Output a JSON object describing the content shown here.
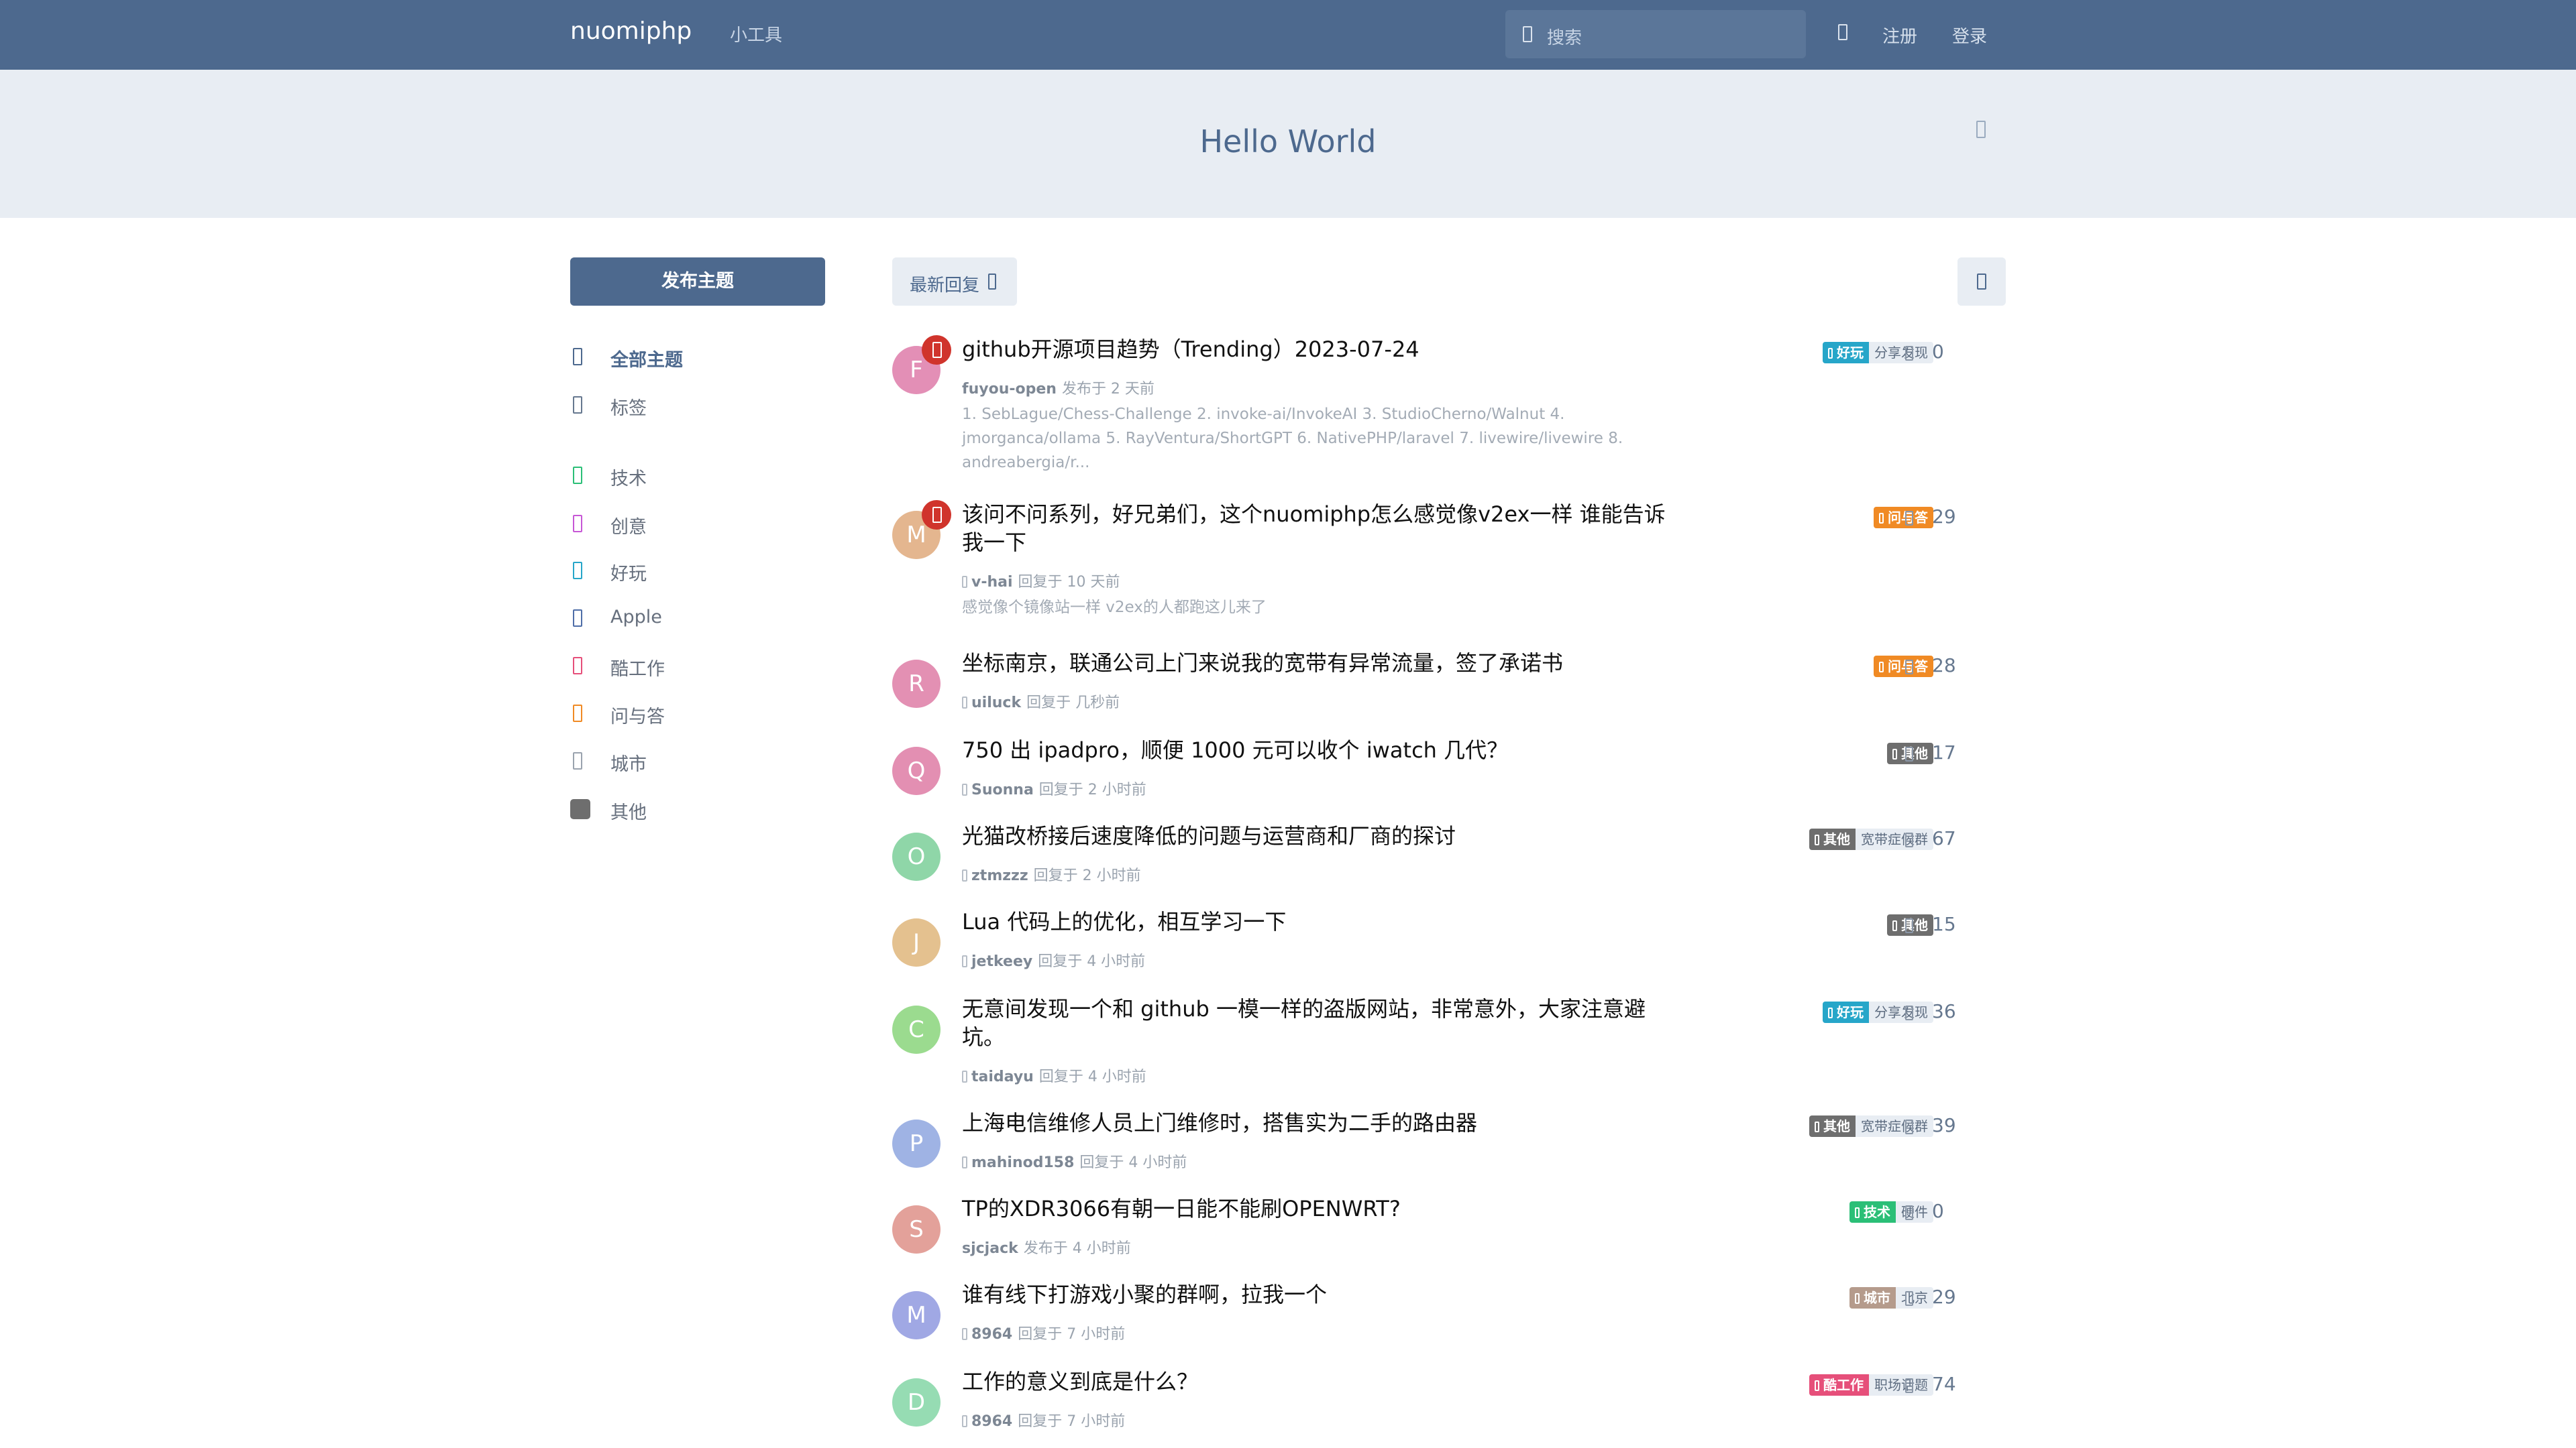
{
  "header": {
    "brand": "nuomiphp",
    "nav_tools": "小工具",
    "search_placeholder": "搜索",
    "register": "注册",
    "login": "登录"
  },
  "hero": {
    "title": "Hello World"
  },
  "sidebar": {
    "new_discussion": "发布主题",
    "items": [
      {
        "label": "全部主题",
        "icon": "comments-icon",
        "color": "#4d698e"
      },
      {
        "label": "标签",
        "icon": "tags-icon",
        "color": "#66788f"
      },
      {
        "label": "技术",
        "icon": "tag-icon",
        "color": "#2bbf77"
      },
      {
        "label": "创意",
        "icon": "tag-icon",
        "color": "#c757d6"
      },
      {
        "label": "好玩",
        "icon": "tag-icon",
        "color": "#26a6c9"
      },
      {
        "label": "Apple",
        "icon": "tag-icon",
        "color": "#4f6ea8"
      },
      {
        "label": "酷工作",
        "icon": "tag-icon",
        "color": "#e64f7a"
      },
      {
        "label": "问与答",
        "icon": "tag-icon",
        "color": "#f08a24"
      },
      {
        "label": "城市",
        "icon": "tag-icon",
        "color": "#9aa3ae"
      },
      {
        "label": "其他",
        "icon": "tag-square-icon",
        "color": "#6e6e6e"
      }
    ]
  },
  "toolbar": {
    "sort_label": "最新回复"
  },
  "discussions": [
    {
      "avatar": "F",
      "avatar_color": "#e38fb6",
      "sticky": true,
      "title": "github开源项目趋势（Trending）2023-07-24",
      "user": "fuyou-open",
      "time": "发布于 2 天前",
      "reply_icon": false,
      "excerpt": "1. SebLague/Chess-Challenge 2. invoke-ai/InvokeAI 3. StudioCherno/Walnut 4. jmorganca/ollama 5. RayVentura/ShortGPT 6. NativePHP/laravel 7. livewire/livewire 8. andreabergia/r...",
      "tag_primary": "好玩",
      "tag_color": "#26a6c9",
      "tag_secondary": "分享发现",
      "count": "0"
    },
    {
      "avatar": "M",
      "avatar_color": "#e4b68f",
      "sticky": true,
      "title": "该问不问系列，好兄弟们，这个nuomiphp怎么感觉像v2ex一样 谁能告诉我一下",
      "user": "v-hai",
      "time": "回复于 10 天前",
      "reply_icon": true,
      "excerpt": "感觉像个镜像站一样 v2ex的人都跑这儿来了",
      "tag_primary": "问与答",
      "tag_color": "#f08a24",
      "tag_secondary": "",
      "count": "29"
    },
    {
      "avatar": "R",
      "avatar_color": "#e390b3",
      "sticky": false,
      "title": "坐标南京，联通公司上门来说我的宽带有异常流量，签了承诺书",
      "user": "uiluck",
      "time": "回复于 几秒前",
      "reply_icon": true,
      "excerpt": "",
      "tag_primary": "问与答",
      "tag_color": "#f08a24",
      "tag_secondary": "",
      "count": "28"
    },
    {
      "avatar": "Q",
      "avatar_color": "#e38fb2",
      "sticky": false,
      "title": "750 出 ipadpro，顺便 1000 元可以收个 iwatch 几代？",
      "user": "Suonna",
      "time": "回复于 2 小时前",
      "reply_icon": true,
      "excerpt": "",
      "tag_primary": "其他",
      "tag_color": "#6e6e6e",
      "tag_secondary": "",
      "count": "17"
    },
    {
      "avatar": "O",
      "avatar_color": "#8fd6a8",
      "sticky": false,
      "title": "光猫改桥接后速度降低的问题与运营商和厂商的探讨",
      "user": "ztmzzz",
      "time": "回复于 2 小时前",
      "reply_icon": true,
      "excerpt": "",
      "tag_primary": "其他",
      "tag_color": "#6e6e6e",
      "tag_secondary": "宽带症候群",
      "count": "67"
    },
    {
      "avatar": "J",
      "avatar_color": "#e4c18f",
      "sticky": false,
      "title": "Lua 代码上的优化，相互学习一下",
      "user": "jetkeey",
      "time": "回复于 4 小时前",
      "reply_icon": true,
      "excerpt": "",
      "tag_primary": "其他",
      "tag_color": "#6e6e6e",
      "tag_secondary": "",
      "count": "15"
    },
    {
      "avatar": "C",
      "avatar_color": "#9bdb8f",
      "sticky": false,
      "title": "无意间发现一个和 github 一模一样的盗版网站，非常意外，大家注意避坑。",
      "user": "taidayu",
      "time": "回复于 4 小时前",
      "reply_icon": true,
      "excerpt": "",
      "tag_primary": "好玩",
      "tag_color": "#26a6c9",
      "tag_secondary": "分享发现",
      "count": "36"
    },
    {
      "avatar": "P",
      "avatar_color": "#9fb3e4",
      "sticky": false,
      "title": "上海电信维修人员上门维修时，搭售实为二手的路由器",
      "user": "mahinod158",
      "time": "回复于 4 小时前",
      "reply_icon": true,
      "excerpt": "",
      "tag_primary": "其他",
      "tag_color": "#6e6e6e",
      "tag_secondary": "宽带症候群",
      "count": "39"
    },
    {
      "avatar": "S",
      "avatar_color": "#e3a19a",
      "sticky": false,
      "title": "TP的XDR3066有朝一日能不能刷OPENWRT?",
      "user": "sjcjack",
      "time": "发布于 4 小时前",
      "reply_icon": false,
      "excerpt": "",
      "tag_primary": "技术",
      "tag_color": "#2bbf77",
      "tag_secondary": "硬件",
      "count": "0"
    },
    {
      "avatar": "M",
      "avatar_color": "#a0a8e4",
      "sticky": false,
      "title": "谁有线下打游戏小聚的群啊，拉我一个",
      "user": "8964",
      "time": "回复于 7 小时前",
      "reply_icon": true,
      "excerpt": "",
      "tag_primary": "城市",
      "tag_color": "#b59b8c",
      "tag_secondary": "北京",
      "count": "29"
    },
    {
      "avatar": "D",
      "avatar_color": "#96dcb3",
      "sticky": false,
      "title": "工作的意义到底是什么？",
      "user": "8964",
      "time": "回复于 7 小时前",
      "reply_icon": true,
      "excerpt": "",
      "tag_primary": "酷工作",
      "tag_color": "#e64f7a",
      "tag_secondary": "职场话题",
      "count": "74"
    }
  ]
}
